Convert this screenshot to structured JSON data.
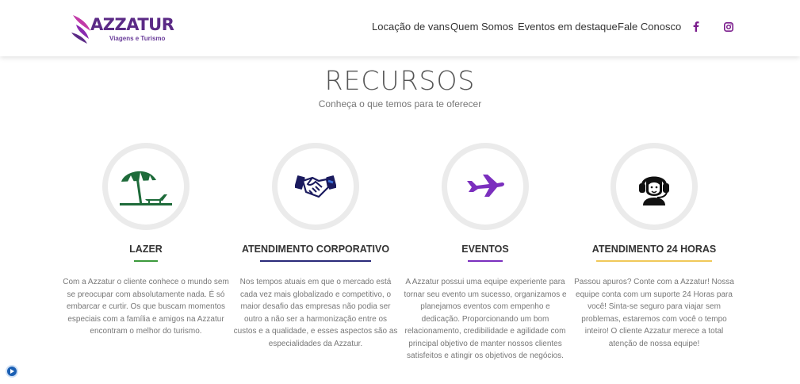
{
  "brand": {
    "logo_text": "AZZATUR",
    "logo_tagline": "Viagens e Turismo",
    "primary_color": "#5b2a86"
  },
  "nav": {
    "items": [
      "Locação de vans",
      "Quem Somos",
      "Eventos em destaque",
      "Fale Conosco"
    ],
    "social": [
      "facebook-icon",
      "instagram-icon"
    ],
    "social_color": "#7a1c8c"
  },
  "section": {
    "title": "RECURSOS",
    "subtitle": "Conheça o que temos para te oferecer"
  },
  "features": [
    {
      "icon": "beach-umbrella-icon",
      "icon_color": "#1e6b3a",
      "title": "LAZER",
      "underline_color": "#3c9a3c",
      "text": "Com a Azzatur o cliente conhece o mundo sem se preocupar com absolutamente nada. É só embarcar e curtir. Os que buscam momentos especiais com a família e amigos na Azzatur encontram o melhor do turismo."
    },
    {
      "icon": "handshake-icon",
      "icon_color": "#1a1a5e",
      "title": "ATENDIMENTO CORPORATIVO",
      "underline_color": "#2a2a7a",
      "text": "Nos tempos atuais em que o mercado está cada vez mais globalizado e competitivo, o maior desafio das empresas não podia ser outro a não ser a harmonização entre os custos e a qualidade, e esses aspectos são as especialidades da Azzatur."
    },
    {
      "icon": "airplane-icon",
      "icon_color": "#7b2fbe",
      "title": "EVENTOS",
      "underline_color": "#7b2fbe",
      "text": "A Azzatur possui uma equipe experiente para tornar seu evento um sucesso, organizamos e planejamos eventos com empenho e dedicação. Proporcionando um bom relacionamento, credibilidade e agilidade com principal objetivo de manter nossos clientes satisfeitos e atingir os objetivos de negócios."
    },
    {
      "icon": "support-agent-icon",
      "icon_color": "#111111",
      "title": "ATENDIMENTO 24 HORAS",
      "underline_color": "#f0c95a",
      "text": "Passou apuros? Conte com a Azzatur! Nossa equipe conta com um suporte 24 Horas para você! Sinta-se seguro para viajar sem problemas, estaremos com você o tempo inteiro! O cliente Azzatur merece a total atenção de nossa equipe!"
    }
  ]
}
